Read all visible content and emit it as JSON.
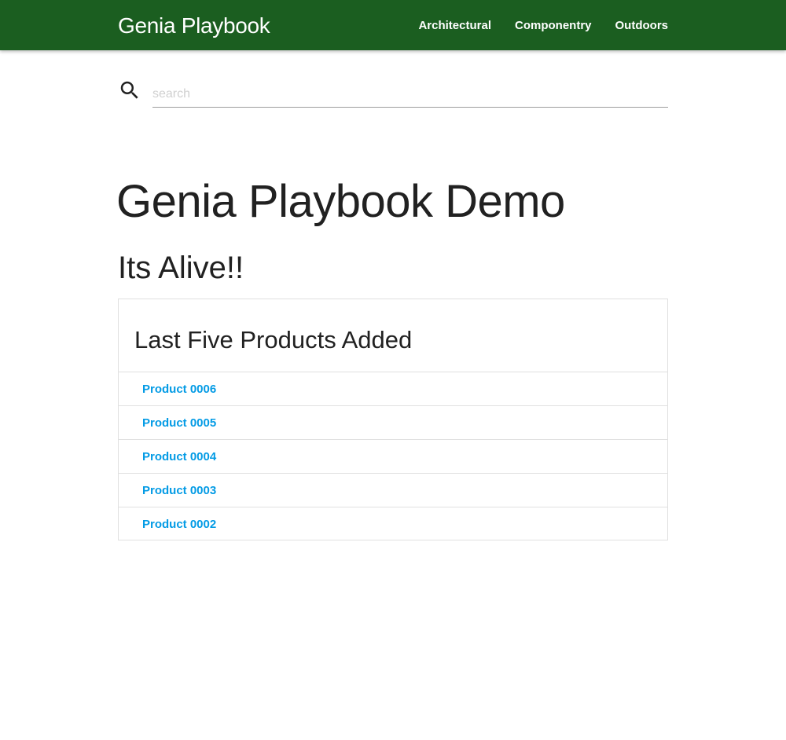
{
  "navbar": {
    "brand": "Genia Playbook",
    "background_color": "#1b5e20",
    "links": [
      {
        "label": "Architectural"
      },
      {
        "label": "Componentry"
      },
      {
        "label": "Outdoors"
      }
    ]
  },
  "search": {
    "icon": "search-icon",
    "placeholder": "search",
    "value": ""
  },
  "main": {
    "title": "Genia Playbook Demo",
    "subtitle": "Its Alive!!",
    "card": {
      "title": "Last Five Products Added",
      "link_color": "#039be5",
      "items": [
        {
          "label": "Product 0006"
        },
        {
          "label": "Product 0005"
        },
        {
          "label": "Product 0004"
        },
        {
          "label": "Product 0003"
        },
        {
          "label": "Product 0002"
        }
      ]
    }
  }
}
